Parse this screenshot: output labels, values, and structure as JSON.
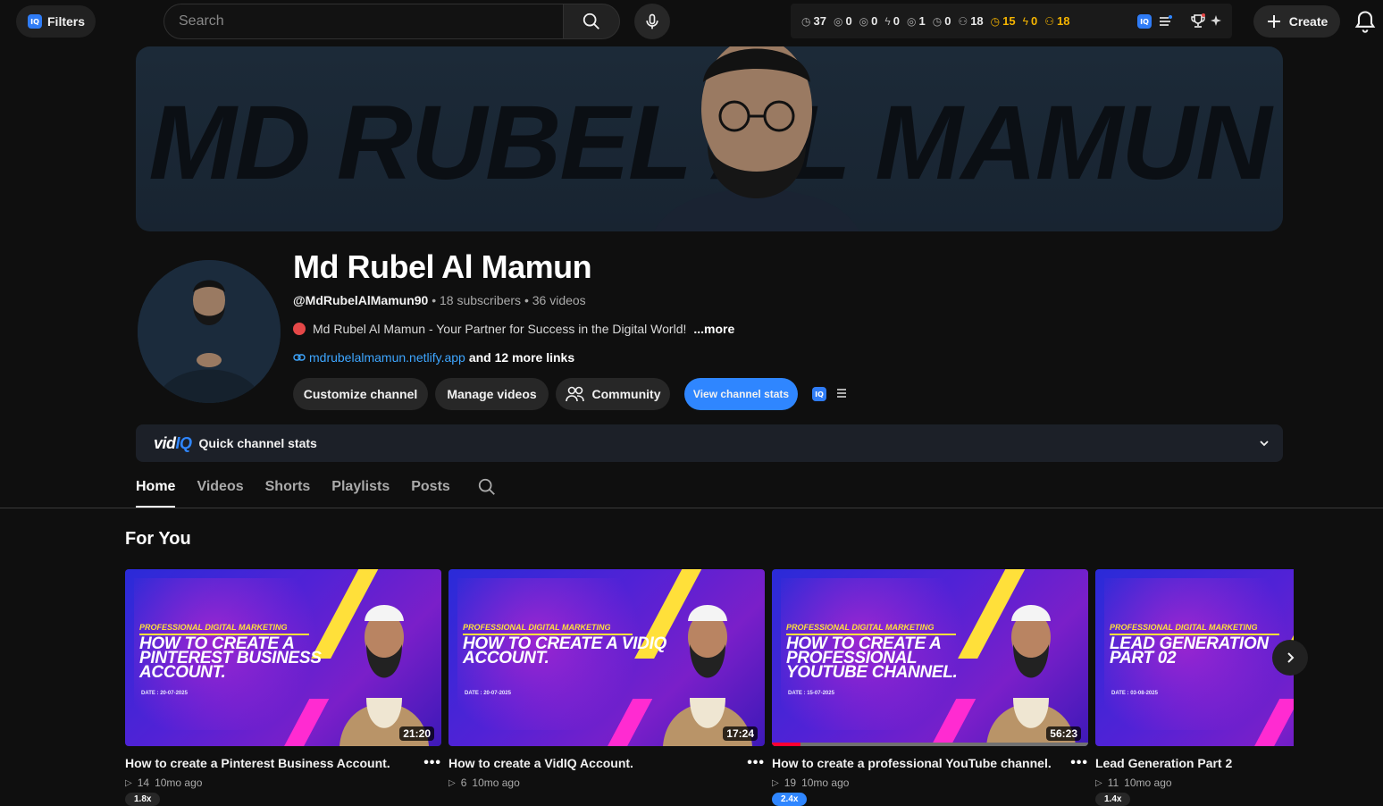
{
  "topbar": {
    "filters_label": "Filters",
    "iq_badge": "IQ",
    "search_placeholder": "Search",
    "stats": [
      {
        "icon": "clock-icon",
        "value": "37",
        "gold": false
      },
      {
        "icon": "eye-icon",
        "value": "0",
        "gold": false
      },
      {
        "icon": "eye-icon",
        "value": "0",
        "gold": false
      },
      {
        "icon": "bolt-icon",
        "value": "0",
        "gold": false
      },
      {
        "icon": "eye-icon",
        "value": "1",
        "gold": false
      },
      {
        "icon": "clock-icon",
        "value": "0",
        "gold": false
      },
      {
        "icon": "person-icon",
        "value": "18",
        "gold": false
      },
      {
        "icon": "clock-icon",
        "value": "15",
        "gold": true
      },
      {
        "icon": "bolt-icon",
        "value": "0",
        "gold": true
      },
      {
        "icon": "person-icon",
        "value": "18",
        "gold": true
      }
    ],
    "create_label": "Create"
  },
  "banner": {
    "text": "MD RUBEL AL MAMUN"
  },
  "channel": {
    "name": "Md Rubel Al Mamun",
    "handle": "@MdRubelAlMamun90",
    "subscribers": "18 subscribers",
    "videos": "36 videos",
    "description": "Md Rubel Al Mamun - Your Partner for Success in the Digital World!",
    "more_label": "...more",
    "link": "mdrubelalmamun.netlify.app",
    "more_links": "and 12 more links",
    "buttons": {
      "customize": "Customize channel",
      "manage": "Manage videos",
      "community": "Community",
      "stats": "View channel stats"
    }
  },
  "vidiq": {
    "logo_vid": "vid",
    "logo_iq": "IQ",
    "label": "Quick channel stats"
  },
  "tabs": [
    "Home",
    "Videos",
    "Shorts",
    "Playlists",
    "Posts"
  ],
  "section_title": "For You",
  "videos": [
    {
      "kicker": "PROFESSIONAL DIGITAL MARKETING",
      "headline": "HOW TO CREATE A PINTEREST BUSINESS ACCOUNT.",
      "date": "DATE : 20-07-2025",
      "duration": "21:20",
      "title": "How to create a Pinterest Business Account.",
      "views": "14",
      "age": "10mo ago",
      "badge": "1.8x",
      "badge_hi": false,
      "progress": 0
    },
    {
      "kicker": "PROFESSIONAL DIGITAL MARKETING",
      "headline": "HOW TO CREATE A VIDIQ ACCOUNT.",
      "date": "DATE : 20-07-2025",
      "duration": "17:24",
      "title": "How to create a VidIQ Account.",
      "views": "6",
      "age": "10mo ago",
      "badge": "",
      "badge_hi": false,
      "progress": 0
    },
    {
      "kicker": "PROFESSIONAL DIGITAL MARKETING",
      "headline": "HOW TO CREATE A PROFESSIONAL YOUTUBE CHANNEL.",
      "date": "DATE : 15-07-2025",
      "duration": "56:23",
      "title": "How to create a professional YouTube channel.",
      "views": "19",
      "age": "10mo ago",
      "badge": "2.4x",
      "badge_hi": true,
      "progress": 0.09
    },
    {
      "kicker": "PROFESSIONAL DIGITAL MARKETING",
      "headline": "LEAD GENERATION PART 02",
      "date": "DATE : 03-08-2025",
      "duration": "",
      "title": "Lead Generation Part 2",
      "views": "11",
      "age": "10mo ago",
      "badge": "1.4x",
      "badge_hi": false,
      "progress": 0
    }
  ],
  "colors": {
    "accent": "#2f86ff",
    "background": "#0f0f0f",
    "stat_gold": "#f5b400"
  }
}
